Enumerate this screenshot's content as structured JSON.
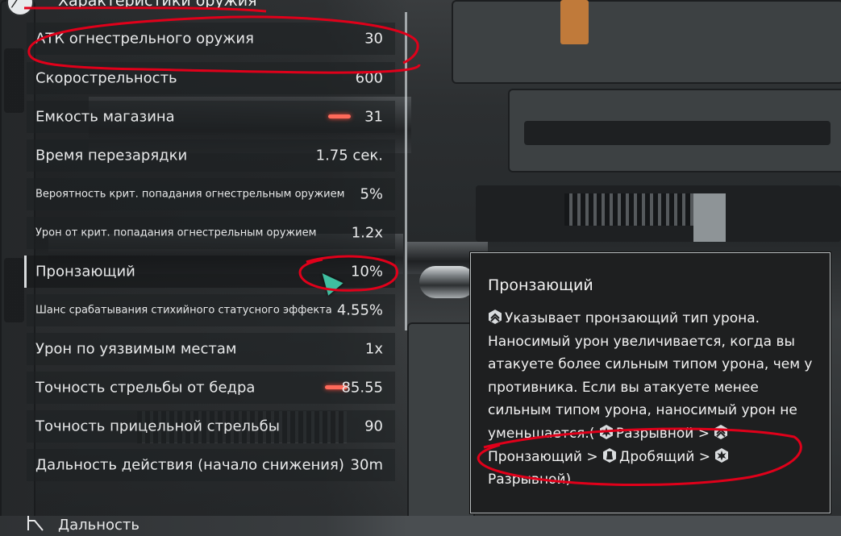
{
  "header": {
    "title": "Характеристики оружия"
  },
  "stats": [
    {
      "label": "АТК огнестрельного оружия",
      "value": "30"
    },
    {
      "label": "Скорострельность",
      "value": "600"
    },
    {
      "label": "Емкость магазина",
      "value": "31"
    },
    {
      "label": "Время перезарядки",
      "value": "1.75 сек."
    },
    {
      "label": "Вероятность крит. попадания огнестрельным оружием",
      "value": "5%"
    },
    {
      "label": "Урон от крит. попадания огнестрельным оружием",
      "value": "1.2x"
    },
    {
      "label": "Пронзающий",
      "value": "10%"
    },
    {
      "label": "Шанс срабатывания стихийного статусного эффекта",
      "value": "4.55%"
    },
    {
      "label": "Урон по уязвимым местам",
      "value": "1x"
    },
    {
      "label": "Точность стрельбы от бедра",
      "value": "85.55"
    },
    {
      "label": "Точность прицельной стрельбы",
      "value": "90"
    },
    {
      "label": "Дальность действия (начало снижения)",
      "value": "30m"
    }
  ],
  "section": {
    "label": "Дальность"
  },
  "tooltip": {
    "title": "Пронзающий",
    "description": "Указывает пронзающий тип урона. Наносимый урон увеличивается, когда вы атакуете более сильным типом урона, чем у противника. Если вы атакуете менее сильным типом урона, наносимый урон не уменьшается.(",
    "chain": [
      {
        "icon": "burst-icon",
        "label": "Разрывной"
      },
      {
        "sep": ">"
      },
      {
        "icon": "pierce-icon",
        "label": "Пронзающий"
      },
      {
        "sep": ">"
      },
      {
        "icon": "crush-icon",
        "label": "Дробящий"
      },
      {
        "sep": ">"
      },
      {
        "icon": "burst-icon",
        "label": "Разрывной"
      }
    ],
    "close": ")"
  },
  "colors": {
    "accent_red": "#ff5a4a",
    "annotation": "#e0001a",
    "cursor": "#3fbfa0"
  }
}
